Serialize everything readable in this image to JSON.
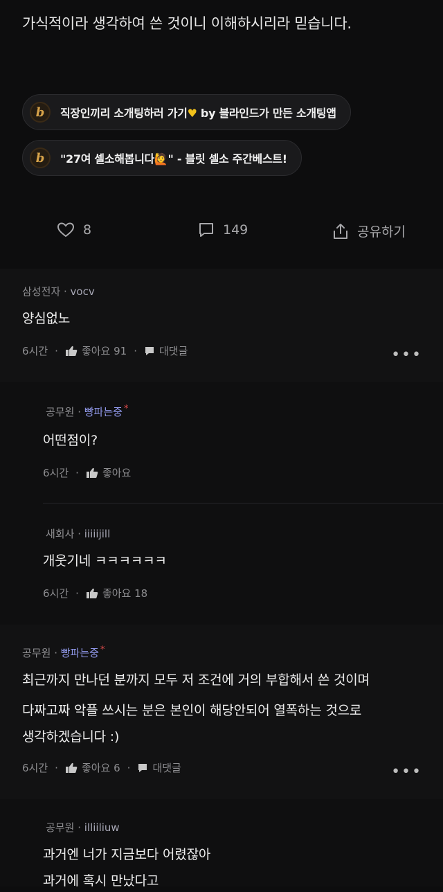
{
  "post": {
    "text": "가식적이라 생각하여 쓴 것이니 이해하시리라 믿습니다."
  },
  "links": [
    {
      "icon_letter": "b",
      "text_before": "직장인끼리 소개팅하러 가기",
      "emoji": "yellow-heart",
      "emoji_char": "♥",
      "text_after": " by 블라인드가 만든 소개팅앱"
    },
    {
      "icon_letter": "b",
      "text_before": "\"27여 셀소해봅니다",
      "emoji": "person-raising-hand",
      "emoji_char": "🙋",
      "text_after": "\" - 블릿 셀소 주간베스트!"
    }
  ],
  "actions": {
    "like_count": "8",
    "comment_count": "149",
    "share_label": "공유하기"
  },
  "comments": [
    {
      "company": "삼성전자",
      "nickname": "vocv",
      "text": "양심없노",
      "time": "6시간",
      "like_label": "좋아요 91",
      "reply_label": "대댓글"
    },
    {
      "company": "공무원",
      "nickname": "빵파는중",
      "author_mark": "*",
      "text": "어떤점이?",
      "time": "6시간",
      "like_label": "좋아요"
    },
    {
      "company": "새회사",
      "nickname": "iiiiijill",
      "text": "개웃기네 ㅋㅋㅋㅋㅋㅋ",
      "time": "6시간",
      "like_label": "좋아요 18"
    },
    {
      "company": "공무원",
      "nickname": "빵파는중",
      "author_mark": "*",
      "lines": [
        "최근까지 만나던 분까지 모두 저 조건에 거의 부합해서 쓴 것이며",
        "다짜고짜 악플 쓰시는 분은 본인이 해당안되어 열폭하는 것으로",
        "생각하겠습니다 :)"
      ],
      "time": "6시간",
      "like_label": "좋아요 6",
      "reply_label": "대댓글"
    },
    {
      "company": "공무원",
      "nickname": "illiiliuw",
      "lines": [
        "과거엔 너가 지금보다 어렸잖아",
        "과거에 혹시 만났다고"
      ]
    }
  ],
  "separator": "·",
  "more_label": "•••",
  "colors": {
    "background": "#0d0d0e",
    "nickname_author": "#8f97e8",
    "brand_icon": "#d7a34a",
    "author_star": "#d94a4a"
  }
}
